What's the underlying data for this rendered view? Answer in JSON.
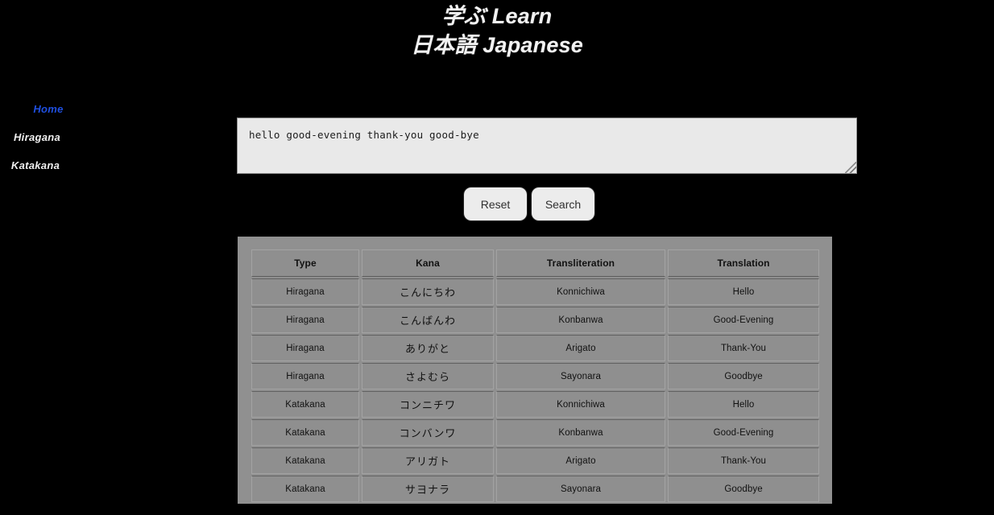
{
  "page": {
    "background_color": "#000000",
    "title_lines": [
      "学ぶ Learn",
      "日本語 Japanese"
    ]
  },
  "sidebar": {
    "items": [
      {
        "label": "Home",
        "active": true,
        "color": "#1f4fe0"
      },
      {
        "label": "Hiragana",
        "active": false,
        "color": "#f0f0f0"
      },
      {
        "label": "Katakana",
        "active": false,
        "color": "#f0f0f0"
      }
    ]
  },
  "search": {
    "textarea_value": "hello good-evening thank-you good-bye",
    "textarea_placeholder": "",
    "reset_label": "Reset",
    "search_label": "Search"
  },
  "results_table": {
    "columns": [
      "Type",
      "Kana",
      "Transliteration",
      "Translation"
    ],
    "rows": [
      {
        "type": "Hiragana",
        "kana": "こんにちわ",
        "transliteration": "Konnichiwa",
        "translation": "Hello"
      },
      {
        "type": "Hiragana",
        "kana": "こんばんわ",
        "transliteration": "Konbanwa",
        "translation": "Good-Evening"
      },
      {
        "type": "Hiragana",
        "kana": "ありがと",
        "transliteration": "Arigato",
        "translation": "Thank-You"
      },
      {
        "type": "Hiragana",
        "kana": "さよむら",
        "transliteration": "Sayonara",
        "translation": "Goodbye"
      },
      {
        "type": "Katakana",
        "kana": "コンニチワ",
        "transliteration": "Konnichiwa",
        "translation": "Hello"
      },
      {
        "type": "Katakana",
        "kana": "コンバンワ",
        "transliteration": "Konbanwa",
        "translation": "Good-Evening"
      },
      {
        "type": "Katakana",
        "kana": "アリガト",
        "transliteration": "Arigato",
        "translation": "Thank-You"
      },
      {
        "type": "Katakana",
        "kana": "サヨナラ",
        "transliteration": "Sayonara",
        "translation": "Goodbye"
      }
    ]
  }
}
